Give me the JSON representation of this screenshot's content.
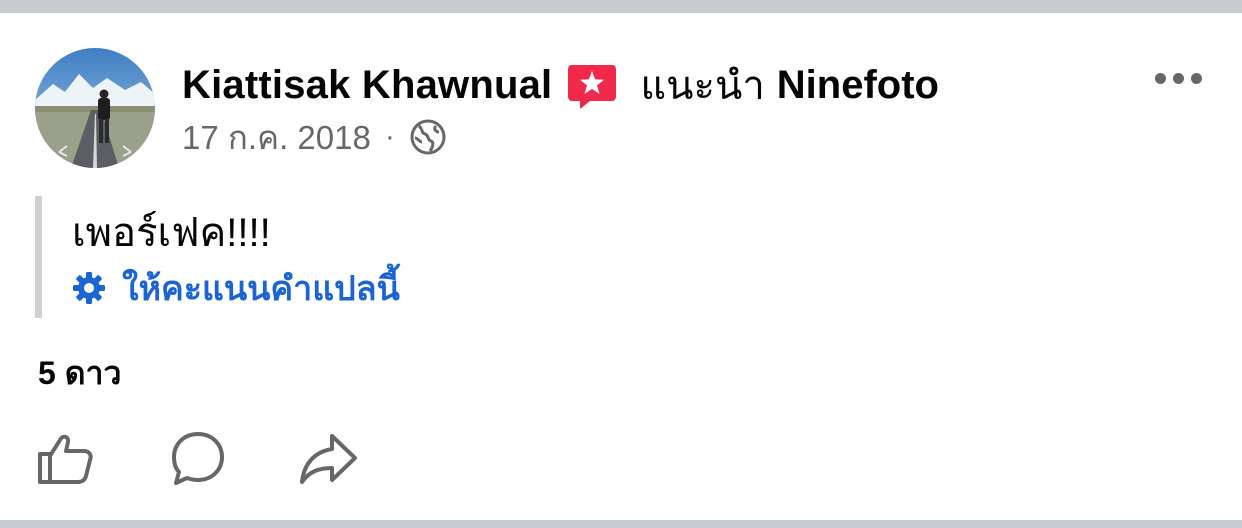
{
  "post": {
    "author_name": "Kiattisak Khawnual",
    "recommendation_label": "แนะนำ",
    "recommended_page": "Ninefoto",
    "date": "17 ก.ค. 2018",
    "meta_separator": "·",
    "audience_icon": "globe-icon",
    "text": "เพอร์เฟค!!!!",
    "translation_link": "ให้คะแนนคำแปลนี้",
    "rating": "5 ดาว"
  },
  "icons": {
    "recommend": "recommend-star-icon",
    "more": "more-options-icon",
    "translate": "gear-icon",
    "like": "thumbs-up-icon",
    "comment": "comment-bubble-icon",
    "share": "share-arrow-icon"
  },
  "colors": {
    "primary_text": "#050505",
    "secondary_text": "#65676b",
    "link": "#1a64d4",
    "recommend_badge": "#f02849",
    "divider": "#c9ccd1"
  }
}
